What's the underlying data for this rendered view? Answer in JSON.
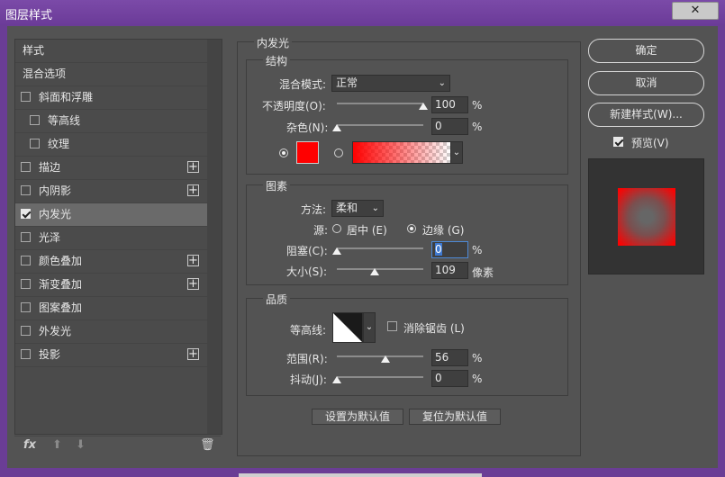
{
  "window": {
    "title": "图层样式",
    "close_label": "✕"
  },
  "left_list": {
    "items": [
      {
        "label": "样式",
        "checkbox": false,
        "checked": false,
        "plus": false,
        "indent": 0,
        "selected": false
      },
      {
        "label": "混合选项",
        "checkbox": false,
        "checked": false,
        "plus": false,
        "indent": 0,
        "selected": false
      },
      {
        "label": "斜面和浮雕",
        "checkbox": true,
        "checked": false,
        "plus": false,
        "indent": 0,
        "selected": false
      },
      {
        "label": "等高线",
        "checkbox": true,
        "checked": false,
        "plus": false,
        "indent": 1,
        "selected": false
      },
      {
        "label": "纹理",
        "checkbox": true,
        "checked": false,
        "plus": false,
        "indent": 1,
        "selected": false
      },
      {
        "label": "描边",
        "checkbox": true,
        "checked": false,
        "plus": true,
        "indent": 0,
        "selected": false
      },
      {
        "label": "内阴影",
        "checkbox": true,
        "checked": false,
        "plus": true,
        "indent": 0,
        "selected": false
      },
      {
        "label": "内发光",
        "checkbox": true,
        "checked": true,
        "plus": false,
        "indent": 0,
        "selected": true
      },
      {
        "label": "光泽",
        "checkbox": true,
        "checked": false,
        "plus": false,
        "indent": 0,
        "selected": false
      },
      {
        "label": "颜色叠加",
        "checkbox": true,
        "checked": false,
        "plus": true,
        "indent": 0,
        "selected": false
      },
      {
        "label": "渐变叠加",
        "checkbox": true,
        "checked": false,
        "plus": true,
        "indent": 0,
        "selected": false
      },
      {
        "label": "图案叠加",
        "checkbox": true,
        "checked": false,
        "plus": false,
        "indent": 0,
        "selected": false
      },
      {
        "label": "外发光",
        "checkbox": true,
        "checked": false,
        "plus": false,
        "indent": 0,
        "selected": false
      },
      {
        "label": "投影",
        "checkbox": true,
        "checked": false,
        "plus": true,
        "indent": 0,
        "selected": false
      }
    ],
    "tools": {
      "fx": "fx",
      "up": "⬆",
      "down": "⬇",
      "trash": "🗑"
    }
  },
  "panel": {
    "title": "内发光",
    "structure": {
      "title": "结构",
      "blend_mode_label": "混合模式:",
      "blend_mode_value": "正常",
      "opacity_label": "不透明度(O):",
      "opacity_value": "100",
      "opacity_level": 100,
      "noise_label": "杂色(N):",
      "noise_value": "0",
      "noise_level": 0,
      "percent": "%",
      "glow_color": "#ff0000"
    },
    "elements": {
      "title": "图素",
      "technique_label": "方法:",
      "technique_value": "柔和",
      "source_label": "源:",
      "source_center": "居中 (E)",
      "source_edge": "边缘 (G)",
      "choke_label": "阻塞(C):",
      "choke_value": "0",
      "choke_level": 0,
      "size_label": "大小(S):",
      "size_value": "109",
      "size_level": 109,
      "size_unit": "像素",
      "percent": "%"
    },
    "quality": {
      "title": "品质",
      "contour_label": "等高线:",
      "antialias_label": "消除锯齿 (L)",
      "range_label": "范围(R):",
      "range_value": "56",
      "range_level": 56,
      "jitter_label": "抖动(J):",
      "jitter_value": "0",
      "jitter_level": 0,
      "percent": "%"
    },
    "buttons": {
      "make_default": "设置为默认值",
      "reset_default": "复位为默认值"
    }
  },
  "right": {
    "ok": "确定",
    "cancel": "取消",
    "new_style": "新建样式(W)...",
    "preview_label": "预览(V)",
    "preview_checked": true
  }
}
